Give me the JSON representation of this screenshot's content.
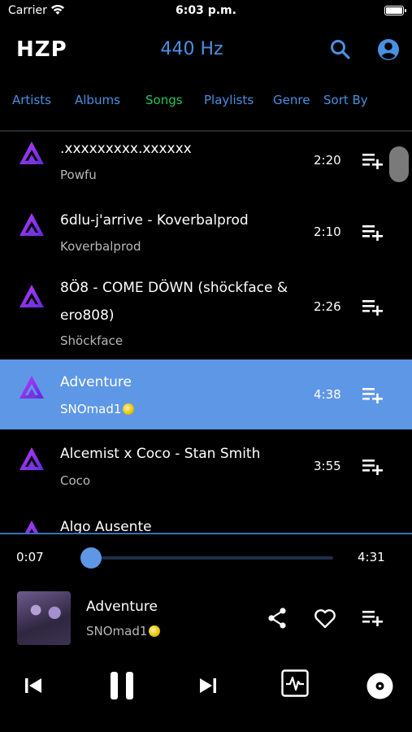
{
  "status_bar": {
    "carrier": "Carrier",
    "time": "6:03 p.m."
  },
  "header": {
    "logo": "HZP",
    "frequency": "440 Hz"
  },
  "tabs": [
    {
      "label": "Artists",
      "active": false
    },
    {
      "label": "Albums",
      "active": false
    },
    {
      "label": "Songs",
      "active": true
    },
    {
      "label": "Playlists",
      "active": false
    },
    {
      "label": "Genre",
      "active": false
    },
    {
      "label": "Sort By",
      "active": false
    }
  ],
  "songs": [
    {
      "title": ".xxxxxxxxx.xxxxxx",
      "artist": "Powfu",
      "duration": "2:20"
    },
    {
      "title": "6dlu-j'arrive - Koverbalprod",
      "artist": "Koverbalprod",
      "duration": "2:10"
    },
    {
      "title": "8Ö8 - COME DÖWN (shöckface & ero808)",
      "artist": "Shöckface",
      "duration": "2:26"
    },
    {
      "title": "Adventure",
      "artist": "SNOmad1",
      "duration": "4:38",
      "selected": true
    },
    {
      "title": "Alcemist x Coco - Stan Smith",
      "artist": "Coco",
      "duration": "3:55"
    },
    {
      "title": "Algo Ausente",
      "artist": "",
      "duration": ""
    }
  ],
  "player": {
    "current_time": "0:07",
    "total_time": "4:31",
    "progress": 0.026,
    "title": "Adventure",
    "artist": "SNOmad1"
  },
  "icons": {
    "search": "search-icon",
    "account": "account-icon",
    "add_to_queue": "playlist-add-icon",
    "share": "share-icon",
    "favorite": "heart-icon",
    "previous": "skip-previous-icon",
    "pause": "pause-icon",
    "next": "skip-next-icon",
    "visualizer": "pulse-icon",
    "disc": "disc-icon"
  },
  "colors": {
    "accent": "#4a90e2",
    "active_tab": "#22c55e",
    "selected_row": "#5e97e6"
  }
}
